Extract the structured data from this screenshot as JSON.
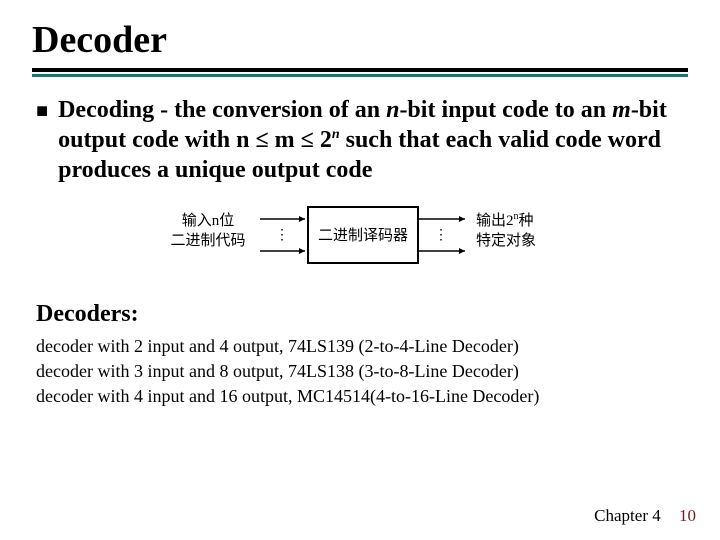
{
  "title": "Decoder",
  "body": {
    "prefix": "Decoding - the conversion of an ",
    "n": "n",
    "mid1": "-bit input code to an ",
    "m": "m",
    "mid2": "-bit output code with n ",
    "le1": "≤",
    "mid3": " m ",
    "le2": "≤",
    "mid4": "  2",
    "sup_n": "n",
    "tail": " such that each valid code word produces a unique output code"
  },
  "diagram": {
    "left_top": "输入n位",
    "left_bot": "二进制代码",
    "center": "二进制译码器",
    "right_top_prefix": "输出2",
    "right_top_sup": "n",
    "right_top_suffix": "种",
    "right_bot": "特定对象"
  },
  "sub_heading": "Decoders:",
  "examples": [
    "decoder with 2 input and 4 output, 74LS139 (2-to-4-Line Decoder)",
    "decoder with 3 input and 8 output, 74LS138 (3-to-8-Line Decoder)",
    "decoder with 4 input and 16 output, MC14514(4-to-16-Line Decoder)"
  ],
  "footer": {
    "chapter": "Chapter 4",
    "page": "10"
  }
}
